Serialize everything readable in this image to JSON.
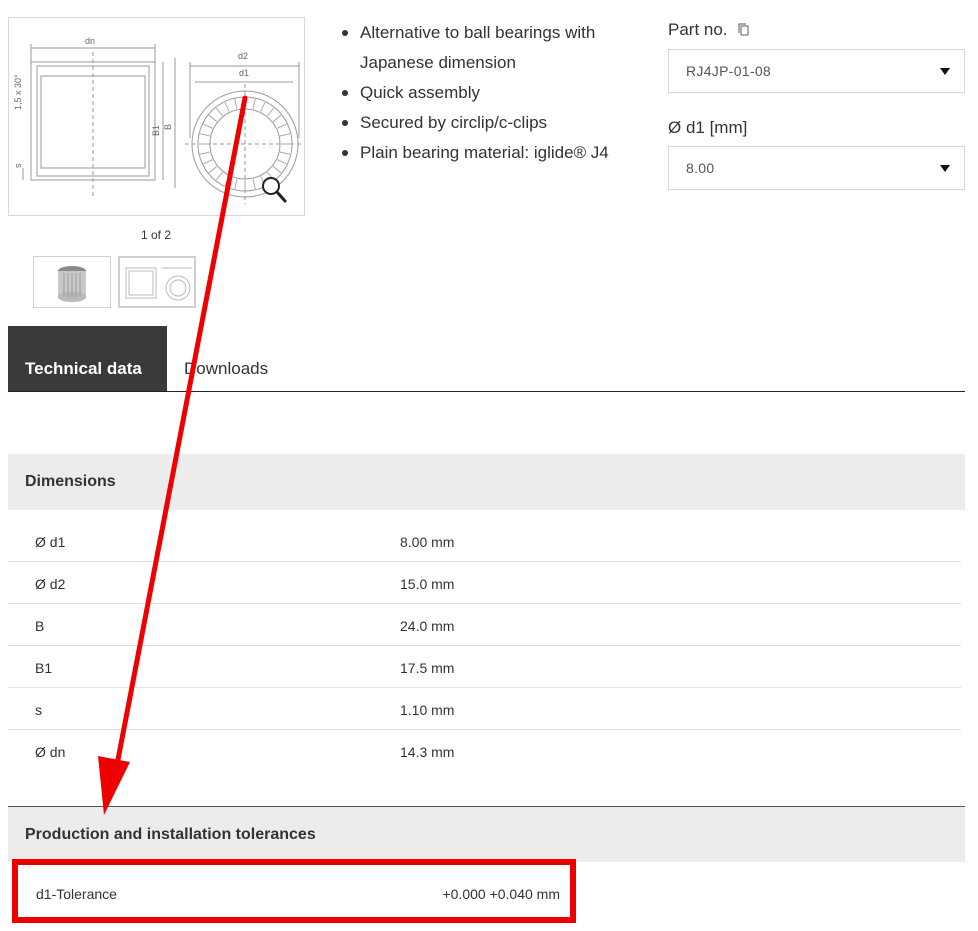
{
  "gallery": {
    "counter": "1 of 2",
    "drawing_labels": [
      "dn",
      "d2",
      "d1",
      "1,5 x 30°",
      "B1",
      "B",
      "s"
    ]
  },
  "features": [
    "Alternative to ball bearings with Japanese dimension",
    "Quick assembly",
    "Secured by circlip/c-clips",
    "Plain bearing material: iglide® J4"
  ],
  "selectors": {
    "part_label": "Part no.",
    "part_value": "RJ4JP-01-08",
    "d1_label": "Ø d1 [mm]",
    "d1_value": "8.00"
  },
  "tabs": {
    "active": "Technical data",
    "other": "Downloads"
  },
  "dimensions": {
    "title": "Dimensions",
    "rows": [
      {
        "key": "Ø d1",
        "value": "8.00 mm"
      },
      {
        "key": "Ø d2",
        "value": "15.0 mm"
      },
      {
        "key": "B",
        "value": "24.0 mm"
      },
      {
        "key": "B1",
        "value": "17.5 mm"
      },
      {
        "key": "s",
        "value": "1.10 mm"
      },
      {
        "key": "Ø dn",
        "value": "14.3 mm"
      }
    ]
  },
  "tolerances": {
    "title": "Production and installation tolerances",
    "key": "d1-Tolerance",
    "value": "+0.000 +0.040 mm"
  },
  "colors": {
    "annotation": "#ee0000",
    "tab_active_bg": "#3a3a3a",
    "section_bg": "#ececec"
  }
}
